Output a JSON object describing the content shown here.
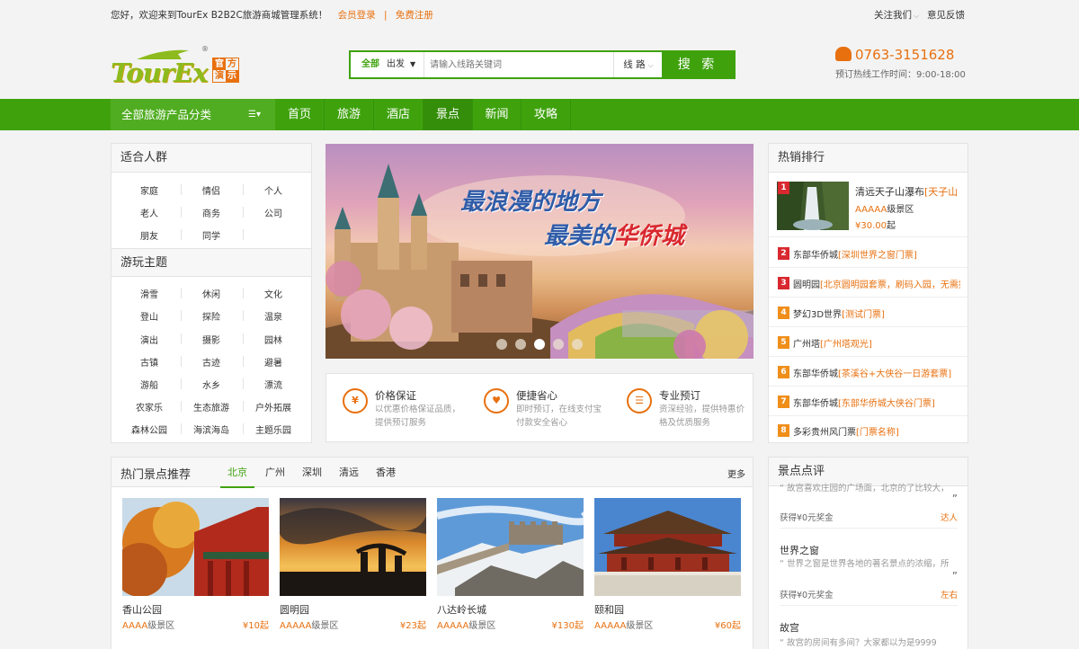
{
  "topbar": {
    "welcome": "您好，欢迎来到TourEx B2B2C旅游商城管理系统！",
    "login": "会员登录",
    "divider": "|",
    "register": "免费注册",
    "follow": "关注我们",
    "feedback": "意见反馈"
  },
  "logo": {
    "word": "TourEx",
    "registered": "®",
    "box": [
      "官",
      "方",
      "演",
      "示"
    ]
  },
  "search": {
    "category_all": "全部",
    "category_sel": "出发",
    "placeholder": "请输入线路关键词",
    "type": "线 路",
    "button": "搜 索"
  },
  "contact": {
    "phone": "0763-3151628",
    "hours": "预订热线工作时间：9:00-18:00"
  },
  "nav": {
    "all_categories": "全部旅游产品分类",
    "items": [
      "首页",
      "旅游",
      "酒店",
      "景点",
      "新闻",
      "攻略"
    ],
    "active_index": 3
  },
  "audience": {
    "title": "适合人群",
    "tags": [
      "家庭",
      "情侣",
      "个人",
      "老人",
      "商务",
      "公司",
      "朋友",
      "同学"
    ]
  },
  "themes": {
    "title": "游玩主题",
    "tags": [
      "滑雪",
      "休闲",
      "文化",
      "登山",
      "探险",
      "温泉",
      "演出",
      "摄影",
      "园林",
      "古镇",
      "古迹",
      "避暑",
      "游船",
      "水乡",
      "漂流",
      "农家乐",
      "生态旅游",
      "户外拓展",
      "森林公园",
      "海滨海岛",
      "主题乐园"
    ]
  },
  "banner": {
    "line1": "最浪漫的地方",
    "line2_prefix": "最美的",
    "line2_highlight": "华侨城",
    "slides": 5,
    "active_slide": 3
  },
  "features": [
    {
      "icon": "¥",
      "title": "价格保证",
      "desc": "以优惠价格保证品质，提供预订服务"
    },
    {
      "icon": "♥",
      "title": "便捷省心",
      "desc": "即时预订，在线支付宝付款安全省心"
    },
    {
      "icon": "☰",
      "title": "专业预订",
      "desc": "资深经验，提供特惠价格及优质服务"
    }
  ],
  "hot_rank": {
    "title": "热销排行",
    "first": {
      "name": "清远天子山瀑布",
      "tag": "[天子山",
      "level": "AAAAA",
      "level_suffix": "级景区",
      "price": "¥30.00",
      "price_suffix": "起"
    },
    "items": [
      {
        "num": "2",
        "name": "东部华侨城",
        "tag": "[深圳世界之窗门票]"
      },
      {
        "num": "3",
        "name": "圆明园",
        "tag": "[北京圆明园套票，刷码入园，无需排"
      },
      {
        "num": "4",
        "name": "梦幻3D世界",
        "tag": "[测试门票]"
      },
      {
        "num": "5",
        "name": "广州塔",
        "tag": "[广州塔观光]"
      },
      {
        "num": "6",
        "name": "东部华侨城",
        "tag": "[茶溪谷+大侠谷一日游套票]"
      },
      {
        "num": "7",
        "name": "东部华侨城",
        "tag": "[东部华侨城大侠谷门票]"
      },
      {
        "num": "8",
        "name": "多彩贵州风门票",
        "tag": "[门票名称]"
      }
    ],
    "badge_colors": {
      "top3": "#d9282f",
      "rest": "#f08e1a"
    }
  },
  "hot_spots": {
    "title": "热门景点推荐",
    "tabs": [
      "北京",
      "广州",
      "深圳",
      "清远",
      "香港"
    ],
    "more": "更多",
    "items": [
      {
        "name": "香山公园",
        "level": "AAAA",
        "level_suffix": "级景区",
        "price": "¥10",
        "price_suffix": "起"
      },
      {
        "name": "圆明园",
        "level": "AAAAA",
        "level_suffix": "级景区",
        "price": "¥23",
        "price_suffix": "起"
      },
      {
        "name": "八达岭长城",
        "level": "AAAAA",
        "level_suffix": "级景区",
        "price": "¥130",
        "price_suffix": "起"
      },
      {
        "name": "颐和园",
        "level": "AAAAA",
        "level_suffix": "级景区",
        "price": "¥60",
        "price_suffix": "起"
      }
    ]
  },
  "reviews": {
    "title": "景点点评",
    "items": [
      {
        "quote": "“ 故宫喜欢庄园的广场面，北京的了比较大，",
        "close": "”",
        "reward": "获得¥0元奖金",
        "user": "达人"
      },
      {
        "spot": "世界之窗",
        "quote": "“ 世界之窗是世界各地的著名景点的浓缩，所",
        "close": "”",
        "reward": "获得¥0元奖金",
        "user": "左右"
      },
      {
        "spot": "故宫",
        "quote": "“ 故宫的房间有多间？大家都以为是9999"
      }
    ]
  },
  "colors": {
    "green": "#3fa20d",
    "orange": "#e8700f",
    "nav_active": "#358e09"
  }
}
